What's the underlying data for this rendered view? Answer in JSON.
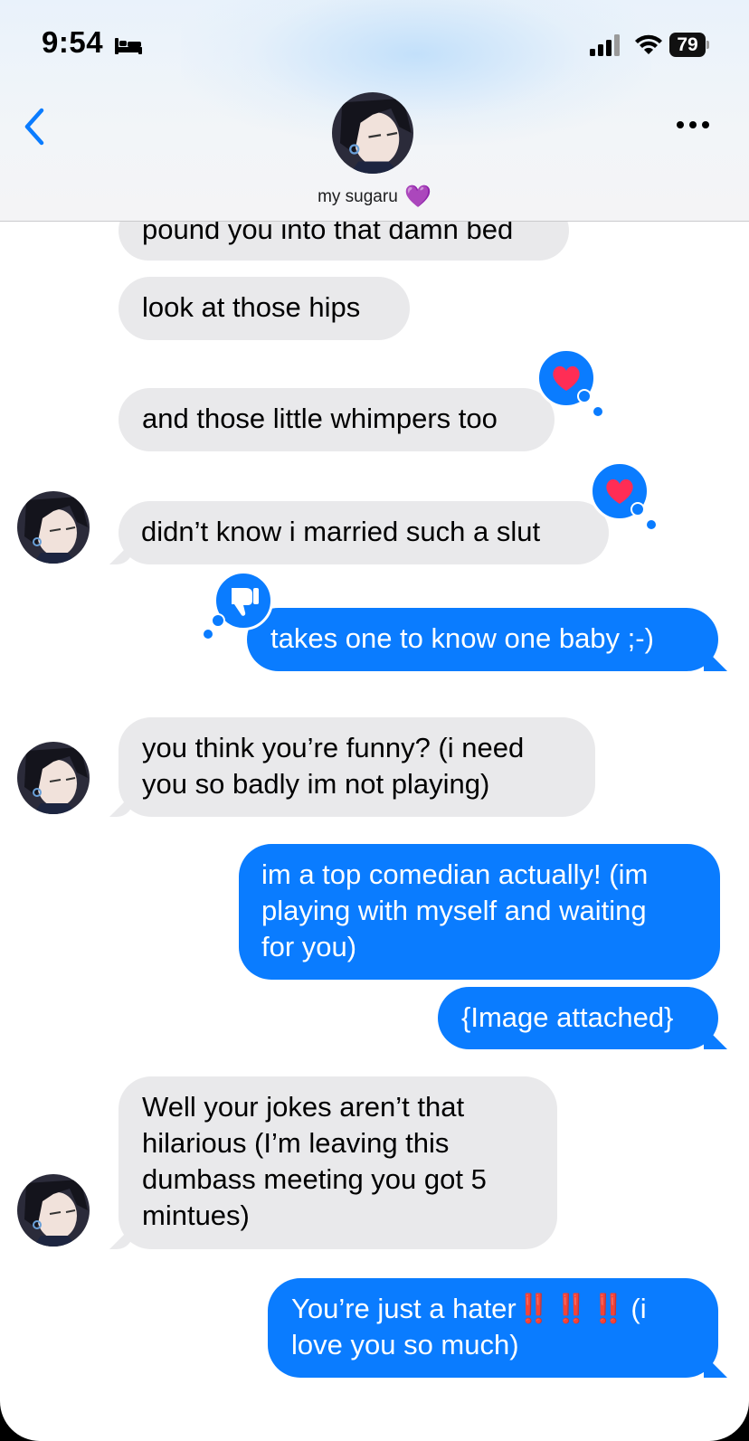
{
  "status_bar": {
    "time": "9:54",
    "battery": "79",
    "icons": [
      "bed-icon",
      "signal-icon",
      "wifi-icon",
      "battery-icon"
    ]
  },
  "header": {
    "contact_name": "my sugaru",
    "contact_emoji": "💜",
    "back_icon": "chevron-left-icon",
    "more_icon": "ellipsis-icon"
  },
  "colors": {
    "outgoing_bubble": "#0a7cff",
    "incoming_bubble": "#e9e9eb",
    "accent": "#0a7cff"
  },
  "messages": [
    {
      "from": "them",
      "text": "pound you into that damn bed"
    },
    {
      "from": "them",
      "text": "look at those hips"
    },
    {
      "from": "them",
      "text": "and those little whimpers too",
      "reaction": "heart"
    },
    {
      "from": "them",
      "text": "didn’t know i married such a slut",
      "reaction": "heart"
    },
    {
      "from": "me",
      "text": "takes one to know one baby ;-)",
      "reaction": "thumbs-down"
    },
    {
      "from": "them",
      "lines": [
        "you think you’re funny? (i need",
        "you so badly im not playing)"
      ]
    },
    {
      "from": "me",
      "lines": [
        "im a top comedian actually! (im",
        "playing with myself and waiting",
        "for you)"
      ]
    },
    {
      "from": "me",
      "text": "{Image attached}"
    },
    {
      "from": "them",
      "lines": [
        "Well your jokes aren’t that",
        "hilarious (I’m leaving this",
        "dumbass meeting you got 5",
        "mintues)"
      ]
    },
    {
      "from": "me",
      "lines": [
        "You’re just a hater",
        "love you so much)"
      ],
      "emphasis": "‼️ ‼️ ‼️",
      "tail_text": " (i"
    }
  ]
}
